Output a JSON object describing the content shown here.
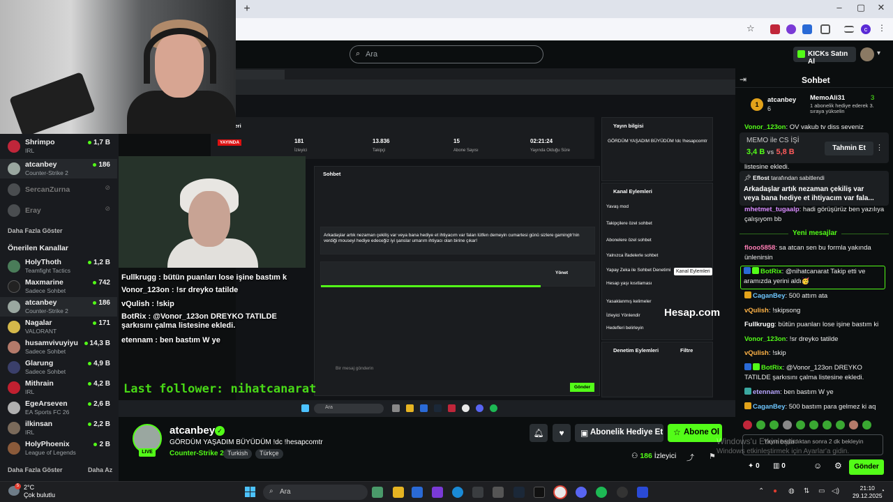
{
  "browser": {
    "new_tab": "+",
    "window_controls": [
      "–",
      "▢",
      "✕"
    ],
    "profile_initial": "c"
  },
  "kick": {
    "search_placeholder": "Ara",
    "kicks_button": "KICKs Satın Al"
  },
  "sidebar": {
    "followed": [
      {
        "name": "Shrimpo",
        "category": "IRL",
        "viewers": "1,7 B"
      },
      {
        "name": "atcanbey",
        "category": "Counter-Strike 2",
        "viewers": "186"
      },
      {
        "name": "SercanZurna",
        "offline": true
      },
      {
        "name": "Eray",
        "offline": true
      }
    ],
    "show_more": "Daha Fazla Göster",
    "recommended_title": "Önerilen Kanallar",
    "recommended": [
      {
        "name": "HolyThoth",
        "category": "Teamfight Tactics",
        "viewers": "1,2 B",
        "color": "#4a7c59"
      },
      {
        "name": "Maxmarine",
        "category": "Sadece Sohbet",
        "viewers": "742",
        "color": "#222"
      },
      {
        "name": "atcanbey",
        "category": "Counter-Strike 2",
        "viewers": "186",
        "color": "#9aa7a0"
      },
      {
        "name": "Nagalar",
        "category": "VALORANT",
        "viewers": "171",
        "color": "#d4b84a"
      },
      {
        "name": "husamvivuyiyu",
        "category": "Sadece Sohbet",
        "viewers": "14,3 B",
        "color": "#b47a6a"
      },
      {
        "name": "Glarung",
        "category": "Sadece Sohbet",
        "viewers": "4,9 B",
        "color": "#3a3f6a"
      },
      {
        "name": "Mithrain",
        "category": "IRL",
        "viewers": "4,2 B",
        "color": "#c02030"
      },
      {
        "name": "EgeArseven",
        "category": "EA Sports FC 26",
        "viewers": "2,6 B",
        "color": "#b0b0b0"
      },
      {
        "name": "ilkinsan",
        "category": "IRL",
        "viewers": "2,2 B",
        "color": "#7a6a5a"
      },
      {
        "name": "HolyPhoenix",
        "category": "League of Legends",
        "viewers": "2 B",
        "color": "#8a5a3a"
      }
    ],
    "show_more_bottom": "Daha Fazla Göster",
    "show_less": "Daha Az"
  },
  "stream_overlay": {
    "chat_lines": [
      {
        "user": "Fullkrugg",
        "text": " : bütün puanları lose işine bastım k"
      },
      {
        "user": "Vonor_123on",
        "text": " : !sr dreyko tatilde"
      },
      {
        "user": "vQulish",
        "text": " : !skip"
      },
      {
        "user": "BotRix",
        "text": " : @Vonor_123on DREYKO TATILDE şarkısını çalma listesine ekledi."
      },
      {
        "user": "etennam",
        "text": " : ben bastım W ye"
      }
    ],
    "last_follower": "Last follower: nihatcanarat",
    "watermark": "Hesap.com",
    "tooltip": "Kanal Eylemleri",
    "dashboard": {
      "stats_title": "İstatistikleri",
      "live": "YAYINDA",
      "stats": [
        {
          "label": "İzleyici",
          "value": "181"
        },
        {
          "label": "Takipçi",
          "value": "13.836"
        },
        {
          "label": "Abone Sayısı",
          "value": "15"
        },
        {
          "label": "Yayında Olduğu Süre",
          "value": "02:21:24"
        }
      ],
      "chat_title": "Sohbet",
      "pinned_text": "Arkadaşlar artık nezaman çekiliş var veya bana hediye et ihtiyacım var falan lütfen demeyin cumartesi günü sizlere gamingtr'nin verdiği mouseyi hediye edeceğiz iyi şanslar umarım ihtiyacı olan birine çıkar!",
      "stream_info_title": "Yayın bilgisi",
      "stream_info_text": "GÖRDÜM YAŞADIM BÜYÜDÜM !dc !hesapcomtr",
      "channel_actions_title": "Kanal Eylemleri",
      "channel_actions": [
        "Yavaş mod",
        "Takipçilere özel sohbet",
        "Abonelere özel sohbet",
        "Yalnızca İfadelerle sohbet",
        "Yapay Zeka ile Sohbet Denetimi",
        "Hesap yaşı kısıtlaması",
        "Yasaklanmış kelimeler",
        "İzleyici Yönlendir",
        "Hedefleri belirleyin"
      ],
      "mod_actions_title": "Denetim Eylemleri",
      "mod_filter": "Filtre",
      "input_placeholder": "Bir mesaj gönderin",
      "send": "Gönder",
      "manage": "Yönet"
    }
  },
  "stream": {
    "channel": "atcanbey",
    "live": "LIVE",
    "title": "GÖRDÜM YAŞADIM BÜYÜDÜM !dc !hesapcomtr",
    "category": "Counter-Strike 2",
    "tags": [
      "Turkish",
      "Türkçe"
    ],
    "gift_label": "Abonelik Hediye Et",
    "subscribe_label": "Abone Ol",
    "viewers": "186",
    "viewers_label": "İzleyici"
  },
  "chat": {
    "title": "Sohbet",
    "top_gifter": {
      "rank": "1",
      "name": "atcanbey",
      "count": "6",
      "gifter_name": "MemoAli31",
      "gifter_count": "3",
      "desc": "1 abonelik hediye ederek 3. sıraya yükselin"
    },
    "prediction": {
      "title": "MEMO ile CS İŞİ",
      "left": "3,4 B",
      "vs": "vs",
      "right": "5,8 B",
      "button": "Tahmin Et"
    },
    "pinned": {
      "by": "Eflost",
      "by_suffix": "tarafından sabitlendi",
      "text": "Arkadaşlar artık nezaman çekiliş var veya bana hediye et ihtiyacım var fala..."
    },
    "pre_messages": [
      {
        "user": "Vonor_123on",
        "text": ": OV vakub tv diss seveniz",
        "color": "#53fc18"
      },
      {
        "user": "",
        "text": "listesine ekledi.",
        "color": "#eee"
      },
      {
        "user": "mhetmet_tugaalp",
        "text": ": hadi görüşürüz ben yazılıya çalışıyom bb",
        "color": "#d98bff"
      }
    ],
    "new_messages": "Yeni mesajlar",
    "messages": [
      {
        "user": "flooo5858",
        "text": ": sa atcan sen bu formla yakında ünlenirsin",
        "color": "#ff7db4"
      },
      {
        "user": "BotRix",
        "text": ": @nihatcanarat Takip etti ve aramızda yerini aldı🥳",
        "color": "#53fc18"
      },
      {
        "user": "CaganBey",
        "text": ": 500 attım ata",
        "color": "#6ec6ff"
      },
      {
        "user": "vQulish",
        "text": ": !skipsong",
        "color": "#ffb347"
      },
      {
        "user": "Fullkrugg",
        "text": ": bütün puanları lose işine bastım ki",
        "color": "#ffffff"
      },
      {
        "user": "Vonor_123on",
        "text": ": !sr dreyko tatilde",
        "color": "#53fc18"
      },
      {
        "user": "vQulish",
        "text": ": !skip",
        "color": "#ffb347"
      },
      {
        "user": "BotRix",
        "text": ": @Vonor_123on DREYKO TATILDE şarkısını çalma listesine ekledi.",
        "color": "#53fc18"
      },
      {
        "user": "etennam",
        "text": ": ben bastım W ye",
        "color": "#b8a6ff"
      },
      {
        "user": "CaganBey",
        "text": ": 500 bastım para gelmez ki aq",
        "color": "#6ec6ff"
      }
    ],
    "input_placeholder": "Yayın başladıktan sonra 2 dk bekleyin",
    "points": "0",
    "points2": "0",
    "send": "Gönder",
    "win_watermark": "Windows'u Etkinleştir",
    "win_watermark2": "Windows etkinleştirmek için Ayarlar'a gidin."
  },
  "taskbar": {
    "weather_temp": "2°C",
    "weather_desc": "Çok bulutlu",
    "notification_count": "5",
    "search": "Ara",
    "time": "21:10",
    "date": "29.12.2025"
  }
}
